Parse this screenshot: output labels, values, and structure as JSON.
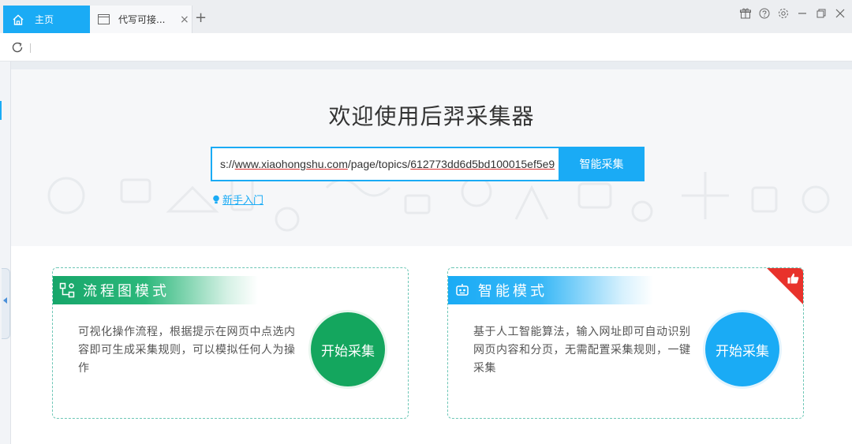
{
  "tabs": {
    "home_label": "主页",
    "doc_label": "代写可接...",
    "close_glyph": "×",
    "add_glyph": "+"
  },
  "window_controls": [
    "gift-icon",
    "help-icon",
    "settings-icon",
    "minimize-icon",
    "restore-icon",
    "close-icon"
  ],
  "hero": {
    "title": "欢迎使用后羿采集器",
    "url_prefix": "s://",
    "url_domain": "www.xiaohongshu.com",
    "url_path": "/page/topics/",
    "url_id": "612773dd6d5bd100015ef5e9",
    "smart_button": "智能采集",
    "guide_link": "新手入门"
  },
  "cards": [
    {
      "title": "流程图模式",
      "description": "可视化操作流程，根据提示在网页中点选内容即可生成采集规则，可以模拟任何人为操作",
      "button": "开始采集",
      "color": "#14a65e"
    },
    {
      "title": "智能模式",
      "description": "基于人工智能算法，输入网址即可自动识别网页内容和分页，无需配置采集规则，一键采集",
      "button": "开始采集",
      "color": "#1aabf5"
    }
  ],
  "colors": {
    "accent": "#1aabf5",
    "green": "#14a65e",
    "ribbon": "#e8322b"
  }
}
